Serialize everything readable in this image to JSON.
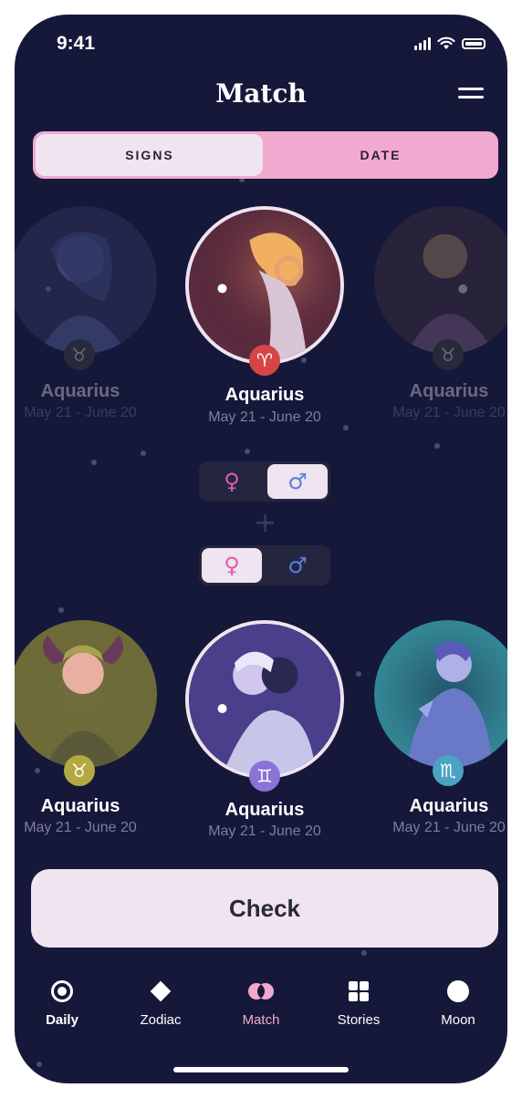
{
  "status": {
    "time": "9:41"
  },
  "header": {
    "title": "Match",
    "menu_icon": "hamburger-menu-icon"
  },
  "segments": {
    "signs": "SIGNS",
    "date": "DATE",
    "selected": "signs"
  },
  "top_row": [
    {
      "name": "Aquarius",
      "dates": "May 21 - June 20",
      "badge": "♉",
      "badge_color": "#4a4a3a",
      "faded": true
    },
    {
      "name": "Aquarius",
      "dates": "May 21 - June 20",
      "badge": "♈",
      "badge_color": "#d64545",
      "faded": false
    },
    {
      "name": "Aquarius",
      "dates": "May 21 - June 20",
      "badge": "♉",
      "badge_color": "#4a4a3a",
      "faded": true
    }
  ],
  "gender_top": {
    "female": "♀",
    "male": "♂",
    "selected": "male"
  },
  "gender_bottom": {
    "female": "♀",
    "male": "♂",
    "selected": "female"
  },
  "plus": "+",
  "bottom_row": [
    {
      "name": "Aquarius",
      "dates": "May 21 - June 20",
      "badge": "♉",
      "badge_color": "#b3a842"
    },
    {
      "name": "Aquarius",
      "dates": "May 21 - June 20",
      "badge": "♊",
      "badge_color": "#8a73d6"
    },
    {
      "name": "Aquarius",
      "dates": "May 21 - June 20",
      "badge": "♏",
      "badge_color": "#4aa3c2"
    }
  ],
  "check_label": "Check",
  "nav": [
    {
      "label": "Daily",
      "icon": "target-icon",
      "active": false
    },
    {
      "label": "Zodiac",
      "icon": "diamond-icon",
      "active": false
    },
    {
      "label": "Match",
      "icon": "match-icon",
      "active": true
    },
    {
      "label": "Stories",
      "icon": "grid-icon",
      "active": false
    },
    {
      "label": "Moon",
      "icon": "moon-icon",
      "active": false
    }
  ],
  "colors": {
    "background": "#16183a",
    "accent_pink": "#f1a9d0",
    "female": "#e05ab0",
    "male": "#5a7ee0"
  }
}
